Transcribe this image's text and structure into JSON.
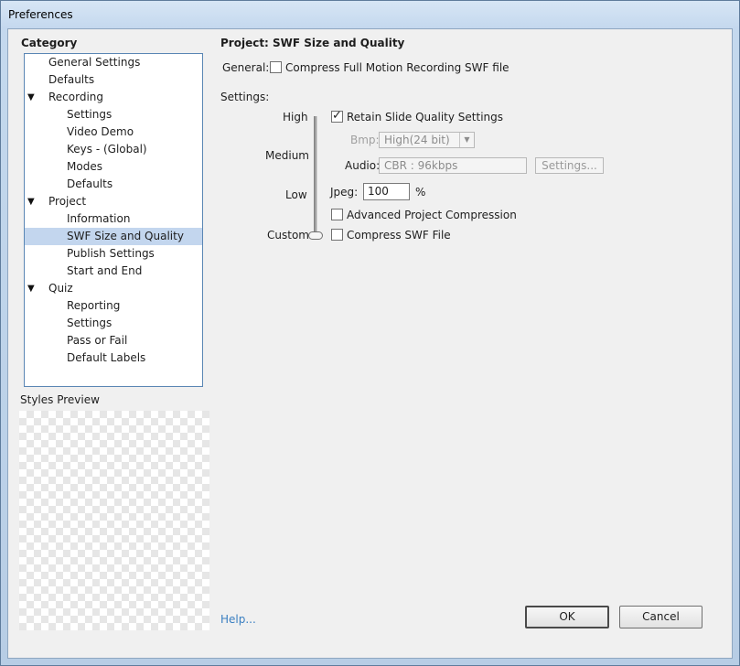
{
  "window": {
    "title": "Preferences"
  },
  "category": {
    "heading": "Category",
    "items": [
      {
        "label": "General Settings",
        "level": 1,
        "expandable": false,
        "selected": false
      },
      {
        "label": "Defaults",
        "level": 1,
        "expandable": false,
        "selected": false
      },
      {
        "label": "Recording",
        "level": 1,
        "expandable": true,
        "selected": false
      },
      {
        "label": "Settings",
        "level": 2,
        "expandable": false,
        "selected": false
      },
      {
        "label": "Video Demo",
        "level": 2,
        "expandable": false,
        "selected": false
      },
      {
        "label": "Keys - (Global)",
        "level": 2,
        "expandable": false,
        "selected": false
      },
      {
        "label": "Modes",
        "level": 2,
        "expandable": false,
        "selected": false
      },
      {
        "label": "Defaults",
        "level": 2,
        "expandable": false,
        "selected": false
      },
      {
        "label": "Project",
        "level": 1,
        "expandable": true,
        "selected": false
      },
      {
        "label": "Information",
        "level": 2,
        "expandable": false,
        "selected": false
      },
      {
        "label": "SWF Size and Quality",
        "level": 2,
        "expandable": false,
        "selected": true
      },
      {
        "label": "Publish Settings",
        "level": 2,
        "expandable": false,
        "selected": false
      },
      {
        "label": "Start and End",
        "level": 2,
        "expandable": false,
        "selected": false
      },
      {
        "label": "Quiz",
        "level": 1,
        "expandable": true,
        "selected": false
      },
      {
        "label": "Reporting",
        "level": 2,
        "expandable": false,
        "selected": false
      },
      {
        "label": "Settings",
        "level": 2,
        "expandable": false,
        "selected": false
      },
      {
        "label": "Pass or Fail",
        "level": 2,
        "expandable": false,
        "selected": false
      },
      {
        "label": "Default Labels",
        "level": 2,
        "expandable": false,
        "selected": false
      }
    ],
    "expand_icon": "▼"
  },
  "styles_preview": {
    "label": "Styles Preview"
  },
  "panel": {
    "title": "Project: SWF Size and Quality",
    "general_label": "General:",
    "compress_motion": {
      "label": "Compress Full Motion Recording SWF file",
      "checked": false
    },
    "settings_label": "Settings:",
    "slider": {
      "high": "High",
      "medium": "Medium",
      "low": "Low",
      "custom": "Custom",
      "current": "Custom"
    },
    "retain_quality": {
      "label": "Retain Slide Quality Settings",
      "checked": true
    },
    "bmp": {
      "label": "Bmp:",
      "value": "High(24 bit)"
    },
    "audio": {
      "label": "Audio:",
      "value": "CBR : 96kbps",
      "settings_button": "Settings..."
    },
    "jpeg": {
      "label": "Jpeg:",
      "value": "100",
      "unit": "%"
    },
    "advanced_compression": {
      "label": "Advanced Project Compression",
      "checked": false
    },
    "compress_swf": {
      "label": "Compress SWF File",
      "checked": false
    }
  },
  "footer": {
    "help_link": "Help...",
    "ok_button": "OK",
    "cancel_button": "Cancel"
  },
  "colors": {
    "selection": "#c3d6ee",
    "tree_border": "#5a86b4",
    "link": "#3a7fc1"
  }
}
